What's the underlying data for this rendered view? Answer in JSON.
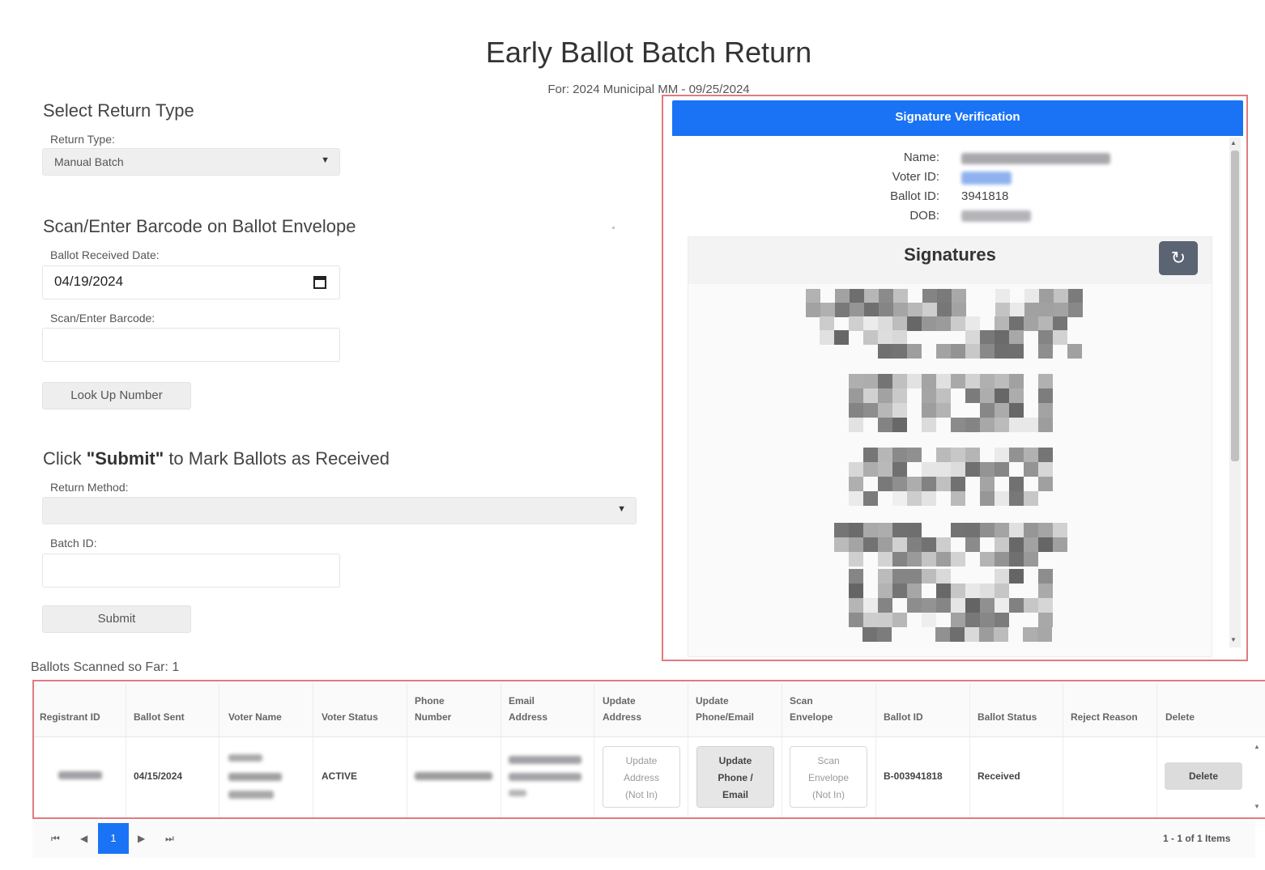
{
  "page": {
    "title": "Early Ballot Batch Return",
    "subtitle": "For: 2024 Municipal MM - 09/25/2024"
  },
  "return_type": {
    "section_title": "Select Return Type",
    "label": "Return Type:",
    "value": "Manual Batch"
  },
  "scan": {
    "section_title": "Scan/Enter Barcode on Ballot Envelope",
    "date_label": "Ballot Received Date:",
    "date_value": "04/19/2024",
    "barcode_label": "Scan/Enter Barcode:",
    "barcode_value": "",
    "lookup_button": "Look Up Number"
  },
  "submit_section": {
    "title_prefix": "Click ",
    "title_bold": "\"Submit\"",
    "title_suffix": " to Mark Ballots as Received",
    "method_label": "Return Method:",
    "method_value": "",
    "batch_label": "Batch ID:",
    "batch_value": "",
    "submit_button": "Submit"
  },
  "signature_panel": {
    "header": "Signature Verification",
    "name_label": "Name:",
    "voter_id_label": "Voter ID:",
    "ballot_id_label": "Ballot ID:",
    "ballot_id_value": "3941818",
    "dob_label": "DOB:",
    "signatures_title": "Signatures",
    "refresh_icon": "refresh-icon"
  },
  "table": {
    "scanned_count_text": "Ballots Scanned so Far: 1",
    "headers": {
      "registrant_id": "Registrant ID",
      "ballot_sent": "Ballot Sent",
      "voter_name": "Voter Name",
      "voter_status": "Voter Status",
      "phone_1": "Phone",
      "phone_2": "Number",
      "email_1": "Email",
      "email_2": "Address",
      "upd_addr_1": "Update",
      "upd_addr_2": "Address",
      "upd_pe_1": "Update",
      "upd_pe_2": "Phone/Email",
      "scan_env_1": "Scan",
      "scan_env_2": "Envelope",
      "ballot_id": "Ballot ID",
      "ballot_status": "Ballot Status",
      "reject_reason": "Reject Reason",
      "delete": "Delete"
    },
    "row": {
      "ballot_sent": "04/15/2024",
      "voter_status": "ACTIVE",
      "update_address": [
        "Update",
        "Address",
        "(Not In)"
      ],
      "update_phone_email": [
        "Update",
        "Phone /",
        "Email"
      ],
      "scan_envelope": [
        "Scan",
        "Envelope",
        "(Not In)"
      ],
      "ballot_id": "B-003941818",
      "ballot_status": "Received",
      "reject_reason": "",
      "delete_button": "Delete"
    },
    "pager": {
      "first": "⏮",
      "prev": "◀",
      "current_page": "1",
      "next": "▶",
      "last": "⏭",
      "summary": "1 - 1 of 1 Items"
    }
  },
  "colors": {
    "accent_blue": "#1a73f5",
    "highlight_outline": "#e27a80"
  }
}
